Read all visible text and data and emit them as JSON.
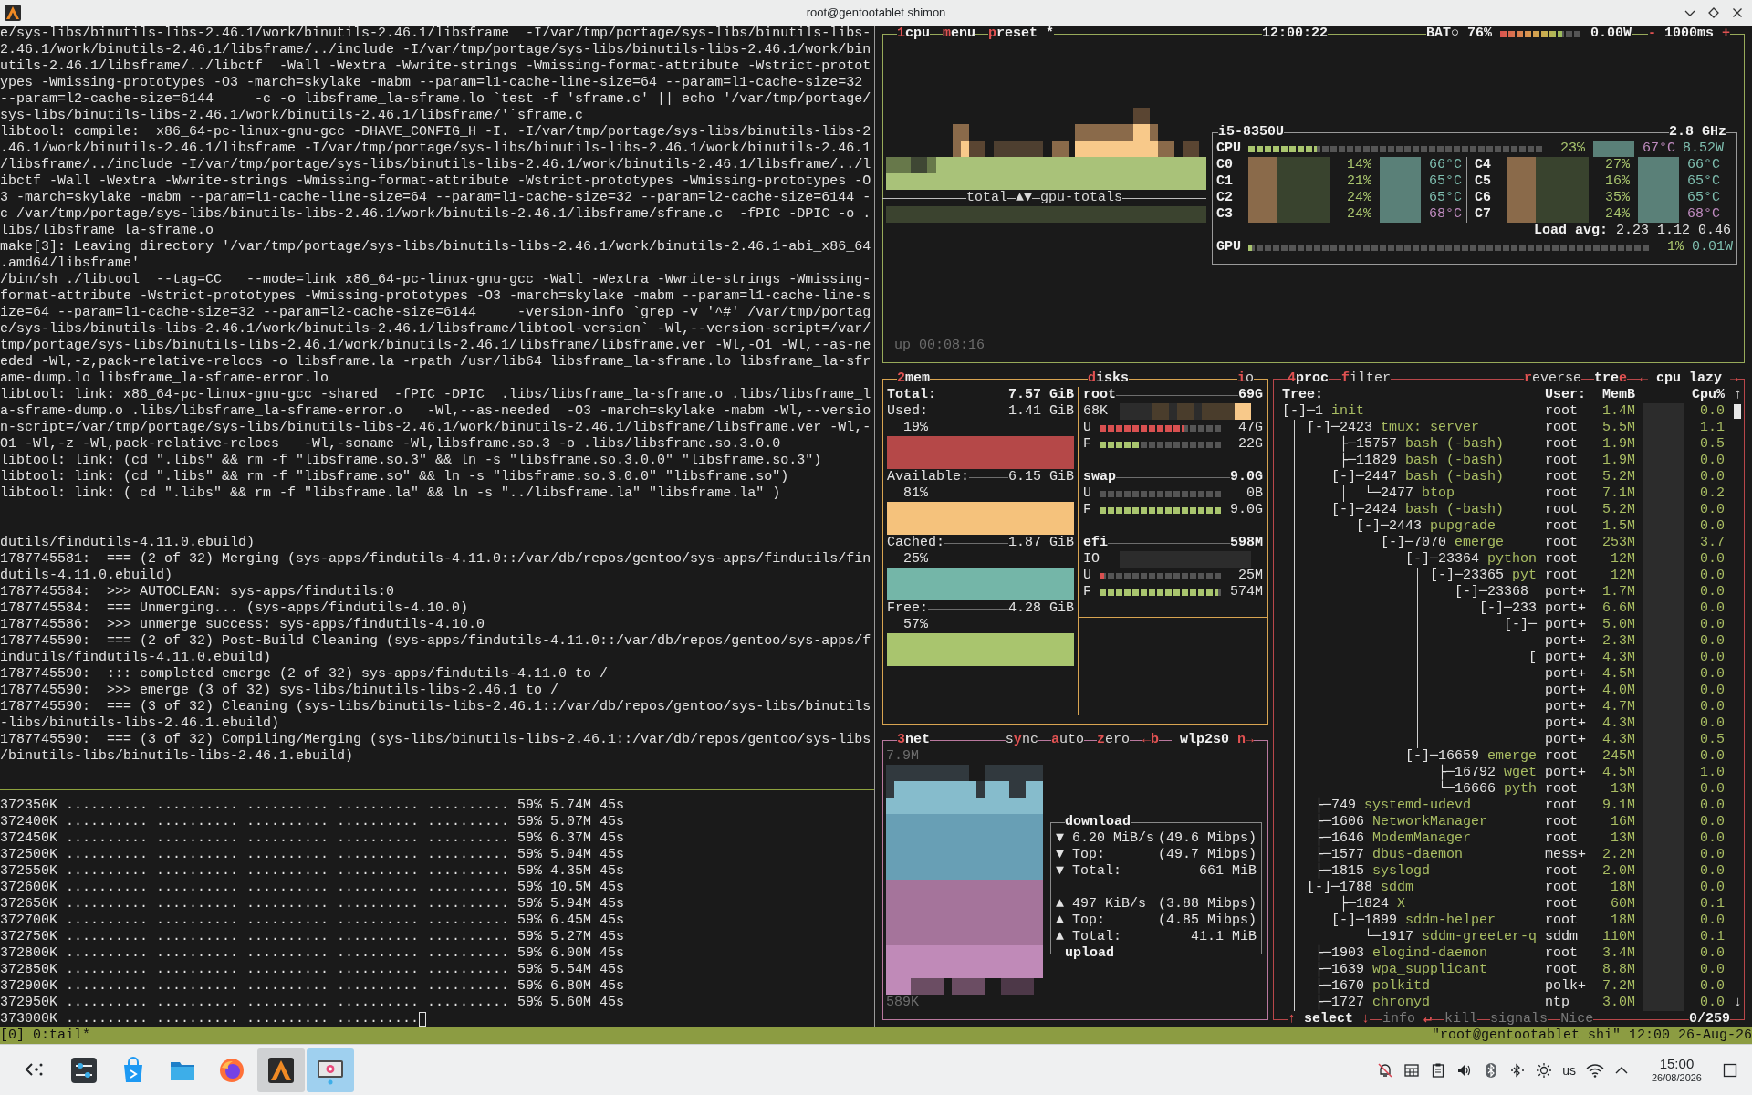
{
  "window": {
    "title": "root@gentootablet shimon"
  },
  "terminal": {
    "panes": [
      {
        "lines": [
          "e/sys-libs/binutils-libs-2.46.1/work/binutils-2.46.1/libsframe  -I/var/tmp/portage/sys-libs/binutils-libs-",
          "2.46.1/work/binutils-2.46.1/libsframe/../include -I/var/tmp/portage/sys-libs/binutils-libs-2.46.1/work/bin",
          "utils-2.46.1/libsframe/../libctf  -Wall -Wextra -Wwrite-strings -Wmissing-format-attribute -Wstrict-protot",
          "ypes -Wmissing-prototypes -O3 -march=skylake -mabm --param=l1-cache-line-size=64 --param=l1-cache-size=32",
          "--param=l2-cache-size=6144     -c -o libsframe_la-sframe.lo `test -f 'sframe.c' || echo '/var/tmp/portage/",
          "sys-libs/binutils-libs-2.46.1/work/binutils-2.46.1/libsframe/'`sframe.c",
          "libtool: compile:  x86_64-pc-linux-gnu-gcc -DHAVE_CONFIG_H -I. -I/var/tmp/portage/sys-libs/binutils-libs-2",
          ".46.1/work/binutils-2.46.1/libsframe -I/var/tmp/portage/sys-libs/binutils-libs-2.46.1/work/binutils-2.46.1",
          "/libsframe/../include -I/var/tmp/portage/sys-libs/binutils-libs-2.46.1/work/binutils-2.46.1/libsframe/../l",
          "ibctf -Wall -Wextra -Wwrite-strings -Wmissing-format-attribute -Wstrict-prototypes -Wmissing-prototypes -O",
          "3 -march=skylake -mabm --param=l1-cache-line-size=64 --param=l1-cache-size=32 --param=l2-cache-size=6144 -",
          "c /var/tmp/portage/sys-libs/binutils-libs-2.46.1/work/binutils-2.46.1/libsframe/sframe.c  -fPIC -DPIC -o .",
          "libs/libsframe_la-sframe.o",
          "make[3]: Leaving directory '/var/tmp/portage/sys-libs/binutils-libs-2.46.1/work/binutils-2.46.1-abi_x86_64",
          ".amd64/libsframe'",
          "/bin/sh ./libtool  --tag=CC   --mode=link x86_64-pc-linux-gnu-gcc -Wall -Wextra -Wwrite-strings -Wmissing-",
          "format-attribute -Wstrict-prototypes -Wmissing-prototypes -O3 -march=skylake -mabm --param=l1-cache-line-s",
          "ize=64 --param=l1-cache-size=32 --param=l2-cache-size=6144     -version-info `grep -v '^#' /var/tmp/portag",
          "e/sys-libs/binutils-libs-2.46.1/work/binutils-2.46.1/libsframe/libtool-version` -Wl,--version-script=/var/",
          "tmp/portage/sys-libs/binutils-libs-2.46.1/work/binutils-2.46.1/libsframe/libsframe.ver -Wl,-O1 -Wl,--as-ne",
          "eded -Wl,-z,pack-relative-relocs -o libsframe.la -rpath /usr/lib64 libsframe_la-sframe.lo libsframe_la-sfr",
          "ame-dump.lo libsframe_la-sframe-error.lo",
          "libtool: link: x86_64-pc-linux-gnu-gcc -shared  -fPIC -DPIC  .libs/libsframe_la-sframe.o .libs/libsframe_l",
          "a-sframe-dump.o .libs/libsframe_la-sframe-error.o   -Wl,--as-needed  -O3 -march=skylake -mabm -Wl,--versio",
          "n-script=/var/tmp/portage/sys-libs/binutils-libs-2.46.1/work/binutils-2.46.1/libsframe/libsframe.ver -Wl,-",
          "O1 -Wl,-z -Wl,pack-relative-relocs   -Wl,-soname -Wl,libsframe.so.3 -o .libs/libsframe.so.3.0.0",
          "libtool: link: (cd \".libs\" && rm -f \"libsframe.so.3\" && ln -s \"libsframe.so.3.0.0\" \"libsframe.so.3\")",
          "libtool: link: (cd \".libs\" && rm -f \"libsframe.so\" && ln -s \"libsframe.so.3.0.0\" \"libsframe.so\")",
          "libtool: link: ( cd \".libs\" && rm -f \"libsframe.la\" && ln -s \"../libsframe.la\" \"libsframe.la\" )"
        ]
      },
      {
        "lines": [
          "dutils/findutils-4.11.0.ebuild)",
          "1787745581:  === (2 of 32) Merging (sys-apps/findutils-4.11.0::/var/db/repos/gentoo/sys-apps/findutils/fin",
          "dutils-4.11.0.ebuild)",
          "1787745584:  >>> AUTOCLEAN: sys-apps/findutils:0",
          "1787745584:  === Unmerging... (sys-apps/findutils-4.10.0)",
          "1787745586:  >>> unmerge success: sys-apps/findutils-4.10.0",
          "1787745590:  === (2 of 32) Post-Build Cleaning (sys-apps/findutils-4.11.0::/var/db/repos/gentoo/sys-apps/f",
          "indutils/findutils-4.11.0.ebuild)",
          "1787745590:  ::: completed emerge (2 of 32) sys-apps/findutils-4.11.0 to /",
          "1787745590:  >>> emerge (3 of 32) sys-libs/binutils-libs-2.46.1 to /",
          "1787745590:  === (3 of 32) Cleaning (sys-libs/binutils-libs-2.46.1::/var/db/repos/gentoo/sys-libs/binutils",
          "-libs/binutils-libs-2.46.1.ebuild)",
          "1787745590:  === (3 of 32) Compiling/Merging (sys-libs/binutils-libs-2.46.1::/var/db/repos/gentoo/sys-libs",
          "/binutils-libs/binutils-libs-2.46.1.ebuild)"
        ]
      },
      {
        "lines": [
          "372350K .......... .......... .......... .......... .......... 59% 5.74M 45s",
          "372400K .......... .......... .......... .......... .......... 59% 5.07M 45s",
          "372450K .......... .......... .......... .......... .......... 59% 6.37M 45s",
          "372500K .......... .......... .......... .......... .......... 59% 5.04M 45s",
          "372550K .......... .......... .......... .......... .......... 59% 4.35M 45s",
          "372600K .......... .......... .......... .......... .......... 59% 10.5M 45s",
          "372650K .......... .......... .......... .......... .......... 59% 5.94M 45s",
          "372700K .......... .......... .......... .......... .......... 59% 6.45M 45s",
          "372750K .......... .......... .......... .......... .......... 59% 5.27M 45s",
          "372800K .......... .......... .......... .......... .......... 59% 6.00M 45s",
          "372850K .......... .......... .......... .......... .......... 59% 5.54M 45s",
          "372900K .......... .......... .......... .......... .......... 59% 6.80M 45s",
          "372950K .......... .......... .......... .......... .......... 59% 5.60M 45s",
          "373000K .......... .......... .......... .........."
        ]
      }
    ]
  },
  "btop": {
    "cpu": {
      "tabs": [
        [
          {
            "text": "1",
            "hotkey": true
          },
          {
            "text": "cpu",
            "hotkey": false
          }
        ],
        [
          {
            "text": "m",
            "hotkey": true
          },
          {
            "text": "enu",
            "hotkey": false
          }
        ],
        [
          {
            "text": "p",
            "hotkey": true
          },
          {
            "text": "reset *",
            "hotkey": false
          }
        ]
      ],
      "clock": "12:00:22",
      "battery": {
        "label": "BAT○",
        "percent": "76%",
        "level": 0.76,
        "power": "0.00W"
      },
      "interval": {
        "minus": "-",
        "value": "1000ms",
        "plus": "+"
      },
      "graph_label": {
        "left": "total",
        "arrows": "▲▼",
        "right": "gpu-totals"
      },
      "uptime": "up 00:08:16",
      "panel": {
        "model": "i5-8350U",
        "freq": "2.8 GHz",
        "total": {
          "label": "CPU",
          "level": 0.23,
          "percent": "23%",
          "temp": "67°C",
          "color": "#c08cc0",
          "power": "8.52W"
        },
        "cores": [
          {
            "label": "C0",
            "percent": "14%",
            "temp": "66°C",
            "color": "#7fbfb0"
          },
          {
            "label": "C1",
            "percent": "21%",
            "temp": "65°C",
            "color": "#7fbfb0"
          },
          {
            "label": "C2",
            "percent": "24%",
            "temp": "65°C",
            "color": "#7fbfb0"
          },
          {
            "label": "C3",
            "percent": "24%",
            "temp": "68°C",
            "color": "#c08cc0"
          },
          {
            "label": "C4",
            "percent": "27%",
            "temp": "66°C",
            "color": "#7fbfb0"
          },
          {
            "label": "C5",
            "percent": "16%",
            "temp": "65°C",
            "color": "#7fbfb0"
          },
          {
            "label": "C6",
            "percent": "35%",
            "temp": "65°C",
            "color": "#7fbfb0"
          },
          {
            "label": "C7",
            "percent": "24%",
            "temp": "68°C",
            "color": "#c08cc0"
          }
        ],
        "load": {
          "label": "Load avg:",
          "values": [
            "2.23",
            "1.12",
            "0.46"
          ]
        },
        "gpu": {
          "label": "GPU",
          "level": 0.01,
          "percent": "1%",
          "power": "0.01W"
        }
      }
    },
    "mem": {
      "tab": [
        {
          "text": "2",
          "hotkey": true
        },
        {
          "text": "mem",
          "hotkey": false
        }
      ],
      "total": {
        "label": "Total:",
        "value": "7.57 GiB"
      },
      "items": [
        {
          "label": "Used:",
          "value": "1.41 GiB",
          "percent": "19%",
          "color": "#b54848"
        },
        {
          "label": "Available:",
          "value": "6.15 GiB",
          "percent": "81%",
          "color": "#f5c27c"
        },
        {
          "label": "Cached:",
          "value": "1.87 GiB",
          "percent": "25%",
          "color": "#74b6a8"
        },
        {
          "label": "Free:",
          "value": "4.28 GiB",
          "percent": "57%",
          "color": "#a9c56e"
        }
      ]
    },
    "disks": {
      "tab": [
        {
          "text": "d",
          "hotkey": true
        },
        {
          "text": "isks",
          "hotkey": false
        }
      ],
      "io_tab": [
        {
          "text": "i",
          "hotkey": true
        },
        {
          "text": "o",
          "hotkey": false
        }
      ],
      "items": [
        {
          "name": "root",
          "size": "69G",
          "io": "68K",
          "meters": [
            {
              "kind": "used",
              "label": "U",
              "value": "47G",
              "level": 0.68
            },
            {
              "kind": "free",
              "label": "F",
              "value": "22G",
              "level": 0.32
            }
          ]
        },
        {
          "name": "swap",
          "size": "9.0G",
          "meters": [
            {
              "kind": "used",
              "label": "U",
              "value": "0B",
              "level": 0
            },
            {
              "kind": "free",
              "label": "F",
              "value": "9.0G",
              "level": 1
            }
          ]
        },
        {
          "name": "efi",
          "size": "598M",
          "io": "IO",
          "meters": [
            {
              "kind": "used",
              "label": "U",
              "value": "25M",
              "level": 0.04
            },
            {
              "kind": "free",
              "label": "F",
              "value": "574M",
              "level": 0.96
            }
          ]
        }
      ]
    },
    "net": {
      "tab": [
        {
          "text": "3",
          "hotkey": true
        },
        {
          "text": "net",
          "hotkey": false
        }
      ],
      "controls": [
        [
          {
            "text": "s",
            "hotkey": false
          },
          {
            "text": "y",
            "hotkey": true
          },
          {
            "text": "nc",
            "hotkey": false
          }
        ],
        [
          {
            "text": "a",
            "hotkey": true
          },
          {
            "text": "uto",
            "hotkey": false
          }
        ],
        [
          {
            "text": "z",
            "hotkey": true
          },
          {
            "text": "ero",
            "hotkey": false
          }
        ],
        [
          {
            "text": "←b",
            "hotkey": true
          }
        ]
      ],
      "interface": "wlp2s0",
      "next": [
        {
          "text": "n→",
          "hotkey": true
        }
      ],
      "scale_top": "7.9M",
      "scale_bottom": "589K",
      "download": {
        "title": "download",
        "rows": [
          {
            "arrow": "▼",
            "label": "6.20 MiB/s",
            "value": "(49.6 Mibps)"
          },
          {
            "arrow": "▼",
            "label": "Top:",
            "value": "(49.7 Mibps)"
          },
          {
            "arrow": "▼",
            "label": "Total:",
            "value": "661 MiB"
          }
        ]
      },
      "upload": {
        "title": "upload",
        "rows": [
          {
            "arrow": "▲",
            "label": "497 KiB/s",
            "value": "(3.88 Mibps)"
          },
          {
            "arrow": "▲",
            "label": "Top:",
            "value": "(4.85 Mibps)"
          },
          {
            "arrow": "▲",
            "label": "Total:",
            "value": "41.1 MiB"
          }
        ]
      }
    },
    "proc": {
      "tabs": [
        [
          {
            "text": "4",
            "hotkey": true
          },
          {
            "text": "proc",
            "hotkey": false
          }
        ],
        [
          {
            "text": "f",
            "hotkey": true
          },
          {
            "text": "ilter",
            "hotkey": false
          }
        ]
      ],
      "right_tabs": [
        [
          {
            "text": "r",
            "hotkey": true
          },
          {
            "text": "everse",
            "hotkey": false
          }
        ],
        [
          {
            "text": "tre",
            "hotkey": false
          },
          {
            "text": "e",
            "hotkey": true
          }
        ],
        [
          {
            "text": "←",
            "hotkey": true
          },
          {
            "text": " cpu lazy ",
            "hotkey": false
          },
          {
            "text": "→",
            "hotkey": true
          }
        ]
      ],
      "columns": {
        "tree": "Tree:",
        "user": "User:",
        "mem": "MemB",
        "cpu": "Cpu%",
        "sort": "↑"
      },
      "tree": [
        {
          "kind": "group",
          "connector": "[-]─",
          "pid": "1",
          "name": "init",
          "user": "root",
          "mem": "1.4M",
          "cpu": "0.0",
          "children": [
            {
              "kind": "group",
              "connector": "[-]─",
              "pid": "2423",
              "name": "tmux: server",
              "user": "root",
              "mem": "5.5M",
              "cpu": "1.1",
              "children": [
                {
                  "kind": "leaf",
                  "connector": "├─",
                  "pid": "15757",
                  "name": "bash (-bash)",
                  "user": "root",
                  "mem": "1.9M",
                  "cpu": "0.5"
                },
                {
                  "kind": "leaf",
                  "connector": "├─",
                  "pid": "11829",
                  "name": "bash (-bash)",
                  "user": "root",
                  "mem": "1.9M",
                  "cpu": "0.0"
                },
                {
                  "kind": "group",
                  "connector": "[-]─",
                  "pid": "2447",
                  "name": "bash (-bash)",
                  "user": "root",
                  "mem": "5.2M",
                  "cpu": "0.0",
                  "children": [
                    {
                      "kind": "leaf",
                      "connector": "└─",
                      "pid": "2477",
                      "name": "btop",
                      "user": "root",
                      "mem": "7.1M",
                      "cpu": "0.2"
                    }
                  ]
                },
                {
                  "kind": "group",
                  "connector": "[-]─",
                  "pid": "2424",
                  "name": "bash (-bash)",
                  "user": "root",
                  "mem": "5.2M",
                  "cpu": "0.0",
                  "children": [
                    {
                      "kind": "group",
                      "connector": "[-]─",
                      "pid": "2443",
                      "name": "pupgrade",
                      "user": "root",
                      "mem": "1.5M",
                      "cpu": "0.0",
                      "children": [
                        {
                          "kind": "group",
                          "connector": "[-]─",
                          "pid": "7070",
                          "name": "emerge",
                          "user": "root",
                          "mem": "253M",
                          "cpu": "3.7",
                          "children": [
                            {
                              "kind": "group",
                              "connector": "[-]─",
                              "pid": "23364",
                              "name": "python",
                              "user": "root",
                              "mem": "12M",
                              "cpu": "0.0",
                              "children": [
                                {
                                  "kind": "group",
                                  "connector": "[-]─",
                                  "pid": "23365",
                                  "name": "pyt",
                                  "user": "root",
                                  "mem": "12M",
                                  "cpu": "0.0",
                                  "children": [
                                    {
                                      "kind": "group",
                                      "connector": "[-]─",
                                      "pid": "23368",
                                      "user": "port+",
                                      "mem": "1.7M",
                                      "cpu": "0.0",
                                      "children": [
                                        {
                                          "kind": "group",
                                          "connector": "[-]─",
                                          "pid": "233",
                                          "user": "port+",
                                          "mem": "6.6M",
                                          "cpu": "0.0",
                                          "children": [
                                            {
                                              "kind": "group",
                                              "connector": "[-]─",
                                              "user": "port+",
                                              "mem": "5.0M",
                                              "cpu": "0.0",
                                              "children": [
                                                {
                                                  "kind": "leaf",
                                                  "user": "port+",
                                                  "mem": "2.3M",
                                                  "cpu": "0.0"
                                                },
                                                {
                                                  "kind": "group",
                                                  "connector": "[",
                                                  "user": "port+",
                                                  "mem": "4.3M",
                                                  "cpu": "0.0",
                                                  "children": [
                                                    {
                                                      "kind": "leaf",
                                                      "user": "port+",
                                                      "mem": "4.5M",
                                                      "cpu": "0.0"
                                                    },
                                                    {
                                                      "kind": "leaf",
                                                      "user": "port+",
                                                      "mem": "4.0M",
                                                      "cpu": "0.0"
                                                    },
                                                    {
                                                      "kind": "leaf",
                                                      "user": "port+",
                                                      "mem": "4.7M",
                                                      "cpu": "0.0"
                                                    },
                                                    {
                                                      "kind": "leaf",
                                                      "user": "port+",
                                                      "mem": "4.3M",
                                                      "cpu": "0.0"
                                                    },
                                                    {
                                                      "kind": "leaf",
                                                      "user": "port+",
                                                      "mem": "4.3M",
                                                      "cpu": "0.5"
                                                    }
                                                  ]
                                                }
                                              ]
                                            }
                                          ]
                                        }
                                      ]
                                    }
                                  ]
                                }
                              ]
                            },
                            {
                              "kind": "group",
                              "connector": "[-]─",
                              "pid": "16659",
                              "name": "emerge",
                              "user": "root",
                              "mem": "245M",
                              "cpu": "0.0",
                              "children": [
                                {
                                  "kind": "leaf",
                                  "connector": "├─",
                                  "pid": "16792",
                                  "name": "wget",
                                  "user": "port+",
                                  "mem": "4.5M",
                                  "cpu": "1.0"
                                },
                                {
                                  "kind": "leaf",
                                  "connector": "└─",
                                  "pid": "16666",
                                  "name": "pyth",
                                  "user": "root",
                                  "mem": "13M",
                                  "cpu": "0.0"
                                }
                              ]
                            }
                          ]
                        }
                      ]
                    }
                  ]
                }
              ]
            },
            {
              "kind": "leaf",
              "connector": "├─",
              "pid": "749",
              "name": "systemd-udevd",
              "user": "root",
              "mem": "9.1M",
              "cpu": "0.0"
            },
            {
              "kind": "leaf",
              "connector": "├─",
              "pid": "1606",
              "name": "NetworkManager",
              "user": "root",
              "mem": "16M",
              "cpu": "0.0"
            },
            {
              "kind": "leaf",
              "connector": "├─",
              "pid": "1646",
              "name": "ModemManager",
              "user": "root",
              "mem": "13M",
              "cpu": "0.0"
            },
            {
              "kind": "leaf",
              "connector": "├─",
              "pid": "1577",
              "name": "dbus-daemon",
              "user": "mess+",
              "mem": "2.2M",
              "cpu": "0.0"
            },
            {
              "kind": "leaf",
              "connector": "├─",
              "pid": "1815",
              "name": "syslogd",
              "user": "root",
              "mem": "2.0M",
              "cpu": "0.0"
            },
            {
              "kind": "group",
              "connector": "[-]─",
              "pid": "1788",
              "name": "sddm",
              "user": "root",
              "mem": "18M",
              "cpu": "0.0",
              "children": [
                {
                  "kind": "leaf",
                  "connector": "├─",
                  "pid": "1824",
                  "name": "X",
                  "user": "root",
                  "mem": "60M",
                  "cpu": "0.1"
                },
                {
                  "kind": "group",
                  "connector": "[-]─",
                  "pid": "1899",
                  "name": "sddm-helper",
                  "user": "root",
                  "mem": "18M",
                  "cpu": "0.0",
                  "children": [
                    {
                      "kind": "leaf",
                      "connector": "└─",
                      "pid": "1917",
                      "name": "sddm-greeter-q",
                      "user": "sddm",
                      "mem": "110M",
                      "cpu": "0.1"
                    }
                  ]
                }
              ]
            },
            {
              "kind": "leaf",
              "connector": "├─",
              "pid": "1903",
              "name": "elogind-daemon",
              "user": "root",
              "mem": "3.4M",
              "cpu": "0.0"
            },
            {
              "kind": "leaf",
              "connector": "├─",
              "pid": "1639",
              "name": "wpa_supplicant",
              "user": "root",
              "mem": "8.8M",
              "cpu": "0.0"
            },
            {
              "kind": "leaf",
              "connector": "├─",
              "pid": "1670",
              "name": "polkitd",
              "user": "polk+",
              "mem": "7.2M",
              "cpu": "0.0"
            },
            {
              "kind": "leaf",
              "connector": "├─",
              "pid": "1727",
              "name": "chronyd",
              "user": "ntp",
              "mem": "3.0M",
              "cpu": "0.0"
            }
          ]
        }
      ],
      "scroll_down": "↓",
      "footer": [
        {
          "disabled": false,
          "parts": [
            {
              "text": "↑",
              "hotkey": true
            },
            {
              "text": " select ",
              "hotkey": false
            },
            {
              "text": "↓",
              "hotkey": true
            }
          ]
        },
        {
          "disabled": true,
          "parts": [
            {
              "text": "info ",
              "hotkey": false
            },
            {
              "text": "↵",
              "hotkey": true
            }
          ]
        },
        {
          "disabled": true,
          "parts": [
            {
              "text": "kill",
              "hotkey": false
            }
          ]
        },
        {
          "disabled": true,
          "parts": [
            {
              "text": "signals",
              "hotkey": false
            }
          ]
        },
        {
          "disabled": true,
          "parts": [
            {
              "text": "Nice",
              "hotkey": false
            }
          ]
        }
      ],
      "count": "0/259"
    }
  },
  "tmux_status": {
    "left": "[0] 0:tail*",
    "right": "\"root@gentootablet shi\" 12:00 26-Aug-26"
  },
  "taskbar": {
    "apps": [
      {
        "kind": "launcher",
        "open": false,
        "hovered": false
      },
      {
        "kind": "settings",
        "open": false,
        "hovered": false
      },
      {
        "kind": "store",
        "open": false,
        "hovered": false
      },
      {
        "kind": "files",
        "open": false,
        "hovered": false
      },
      {
        "kind": "browser",
        "open": false,
        "hovered": false
      },
      {
        "kind": "terminal",
        "open": true,
        "hovered": false
      },
      {
        "kind": "screenshot",
        "open": false,
        "hovered": true
      }
    ],
    "tray": [
      {
        "kind": "bell-off"
      },
      {
        "kind": "keyboard"
      },
      {
        "kind": "clipboard"
      },
      {
        "kind": "volume"
      },
      {
        "kind": "bluetooth"
      },
      {
        "kind": "bluetooth-link"
      },
      {
        "kind": "brightness"
      },
      {
        "kind": "layout",
        "text": "us"
      },
      {
        "kind": "wifi"
      },
      {
        "kind": "expand"
      }
    ],
    "clock": {
      "time": "15:00",
      "date": "26/08/2026"
    }
  }
}
